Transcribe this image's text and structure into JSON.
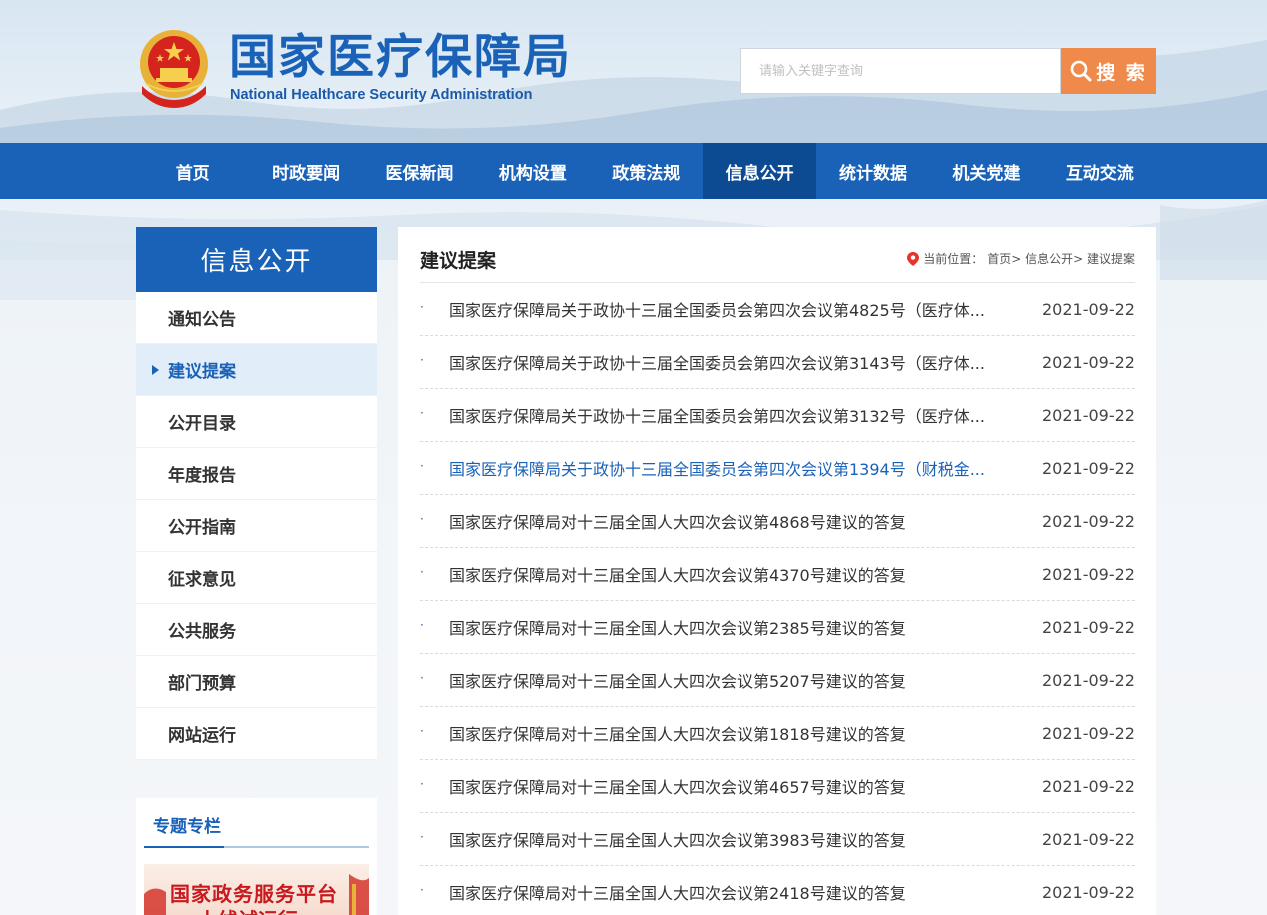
{
  "header": {
    "logo_cn": "国家医疗保障局",
    "logo_en": "National Healthcare Security Administration",
    "search_placeholder": "请输入关键字查询",
    "search_button": "搜 索"
  },
  "nav": [
    {
      "label": "首页",
      "active": false
    },
    {
      "label": "时政要闻",
      "active": false
    },
    {
      "label": "医保新闻",
      "active": false
    },
    {
      "label": "机构设置",
      "active": false
    },
    {
      "label": "政策法规",
      "active": false
    },
    {
      "label": "信息公开",
      "active": true
    },
    {
      "label": "统计数据",
      "active": false
    },
    {
      "label": "机关党建",
      "active": false
    },
    {
      "label": "互动交流",
      "active": false
    }
  ],
  "sidebar": {
    "title": "信息公开",
    "items": [
      {
        "label": "通知公告",
        "active": false
      },
      {
        "label": "建议提案",
        "active": true
      },
      {
        "label": "公开目录",
        "active": false
      },
      {
        "label": "年度报告",
        "active": false
      },
      {
        "label": "公开指南",
        "active": false
      },
      {
        "label": "征求意见",
        "active": false
      },
      {
        "label": "公共服务",
        "active": false
      },
      {
        "label": "部门预算",
        "active": false
      },
      {
        "label": "网站运行",
        "active": false
      }
    ],
    "special_title": "专题专栏",
    "banner_line1": "国家政务服务平台",
    "banner_line2": "上线试运行"
  },
  "main": {
    "title": "建议提案",
    "breadcrumb_label": "当前位置：",
    "breadcrumb": "首页> 信息公开> 建议提案",
    "items": [
      {
        "title": "国家医疗保障局关于政协十三届全国委员会第四次会议第4825号（医疗体...",
        "date": "2021-09-22",
        "highlight": false
      },
      {
        "title": "国家医疗保障局关于政协十三届全国委员会第四次会议第3143号（医疗体...",
        "date": "2021-09-22",
        "highlight": false
      },
      {
        "title": "国家医疗保障局关于政协十三届全国委员会第四次会议第3132号（医疗体...",
        "date": "2021-09-22",
        "highlight": false
      },
      {
        "title": "国家医疗保障局关于政协十三届全国委员会第四次会议第1394号（财税金...",
        "date": "2021-09-22",
        "highlight": true
      },
      {
        "title": "国家医疗保障局对十三届全国人大四次会议第4868号建议的答复",
        "date": "2021-09-22",
        "highlight": false
      },
      {
        "title": "国家医疗保障局对十三届全国人大四次会议第4370号建议的答复",
        "date": "2021-09-22",
        "highlight": false
      },
      {
        "title": "国家医疗保障局对十三届全国人大四次会议第2385号建议的答复",
        "date": "2021-09-22",
        "highlight": false
      },
      {
        "title": "国家医疗保障局对十三届全国人大四次会议第5207号建议的答复",
        "date": "2021-09-22",
        "highlight": false
      },
      {
        "title": "国家医疗保障局对十三届全国人大四次会议第1818号建议的答复",
        "date": "2021-09-22",
        "highlight": false
      },
      {
        "title": "国家医疗保障局对十三届全国人大四次会议第4657号建议的答复",
        "date": "2021-09-22",
        "highlight": false
      },
      {
        "title": "国家医疗保障局对十三届全国人大四次会议第3983号建议的答复",
        "date": "2021-09-22",
        "highlight": false
      },
      {
        "title": "国家医疗保障局对十三届全国人大四次会议第2418号建议的答复",
        "date": "2021-09-22",
        "highlight": false
      }
    ]
  },
  "colors": {
    "brand_blue": "#1a62b8",
    "nav_active": "#0c4a92",
    "search_orange": "#f08a4b"
  }
}
